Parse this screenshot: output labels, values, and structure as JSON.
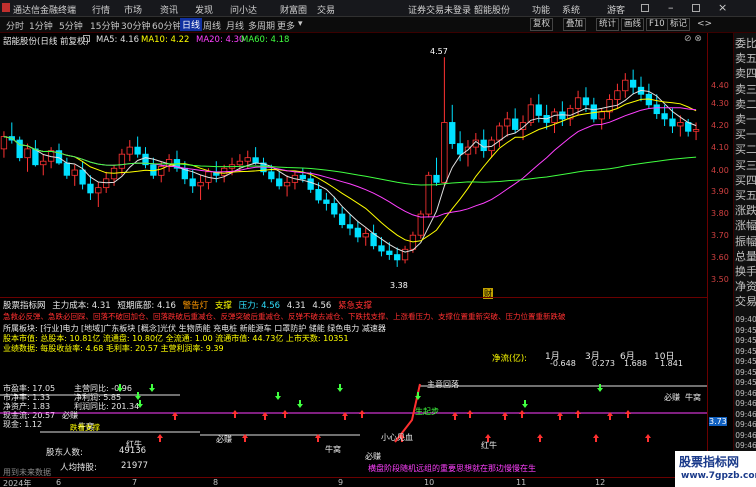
{
  "menu": {
    "app_title": "通达信金融终端",
    "items": [
      "行情",
      "市场",
      "资讯",
      "发现",
      "问小达",
      "财富圈",
      "交易"
    ],
    "notice_left": "证券交易未登录",
    "notice_right": "韶能股份",
    "right_items": [
      "功能",
      "系统",
      "游客"
    ]
  },
  "periods": {
    "items": [
      "分时",
      "1分钟",
      "5分钟",
      "15分钟",
      "30分钟",
      "60分钟",
      "日线",
      "周线",
      "月线",
      "多周期",
      "更多"
    ],
    "active_index": 6,
    "tools": [
      "复权",
      "叠加",
      "统计",
      "画线",
      "F10",
      "标记"
    ]
  },
  "main": {
    "stock_label": "韶能股份(日线 前复权)",
    "ma": [
      {
        "label": "MA5: 4.16",
        "color": "#e0e0e0"
      },
      {
        "label": "MA10: 4.22",
        "color": "#ffff00"
      },
      {
        "label": "MA20: 4.30",
        "color": "#ff40ff"
      },
      {
        "label": "MA60: 4.18",
        "color": "#40ff40"
      }
    ],
    "high_label": "4.57",
    "low_label": "3.38",
    "marker": "财"
  },
  "axis_ticks": [
    "4.40",
    "4.30",
    "4.20",
    "4.10",
    "4.00",
    "3.90",
    "3.80",
    "3.70",
    "3.60",
    "3.50"
  ],
  "sub_axis_tick": "3.73",
  "sidebar": {
    "items": [
      "委比",
      "卖五",
      "卖四",
      "卖三",
      "卖二",
      "卖一",
      "买一",
      "买二",
      "买三",
      "买四",
      "买五",
      "涨跌",
      "涨幅",
      "振幅",
      "总量",
      "换手",
      "净资",
      "交易"
    ],
    "times": [
      "09:40",
      "09:45",
      "09:45",
      "09:45",
      "09:45",
      "09:45",
      "09:45",
      "09:46",
      "09:46",
      "09:46",
      "09:46",
      "09:46",
      "09:46",
      "09:46",
      "09:46"
    ]
  },
  "indicator": {
    "header": "股票指标网",
    "main_cost": "主力成本: 4.31",
    "short_ma": "短期底部: 4.16",
    "alert": "警告灯",
    "support": "支撑",
    "pressure": "压力: 4.56",
    "v1": "4.31",
    "v2": "4.56",
    "tip": "紧急支撑",
    "line2": "急救必反弹、急跌必回踩、回落不破回加仓、回落跌破后重减仓、反弹突破后重减仓、反弹不破去减仓、下跌找支撑、上涨看压力、支撑位置重新突破、压力位置重新跌破"
  },
  "info": {
    "sector": "所属板块: [行业]电力 [地域]广东板块 [概念]光伏 生物质能 充电桩 新能源车 口罩防护 储能 绿色电力 减速器",
    "equity": "股本市值: 总股本: 10.81亿 流通盘: 10.80亿 全流通: 1.00 流通市值: 44.73亿 上市天数: 10351",
    "finance": "业绩数据: 每股收益率: 4.68 毛利率: 20.57 主营利润率: 9.39",
    "jingliu": "净流(亿):",
    "months": [
      "1月",
      "3月",
      "6月",
      "10日"
    ],
    "jl_vals": [
      "-0.648",
      "0.273",
      "1.688",
      "1.841"
    ],
    "pe_label": "市盈率: 17.05",
    "pb": "市净率: 1.33",
    "roe": "净资产: 1.83",
    "cash": "现金流: 20.57",
    "cur": "现金: 1.12",
    "growth": "主营同比: -0.96",
    "net": "净利润: 5.85",
    "profit": "利润同比: 201.34",
    "holders_label": "股东人数:",
    "holders": "49136",
    "per_label": "人均持股:",
    "per": "21977",
    "signals": [
      "主意回落",
      "生起步",
      "小心见血",
      "必赚",
      "必赚",
      "必赚",
      "必赚",
      "牛窝",
      "牛窝",
      "牛窝",
      "红牛",
      "红牛",
      "跌看支撑"
    ],
    "scroll_text": "横盘阶段随机远组的重要思想就在那边慢慢在生",
    "footer": "用到未来数据"
  },
  "dates": [
    "2024年",
    "6",
    "7",
    "8",
    "9",
    "10",
    "11",
    "12"
  ],
  "watermark": {
    "line1": "股票指标网",
    "line2": "www.7gpzb.com"
  },
  "chart_data": {
    "type": "candlestick",
    "title": "韶能股份(日线 前复权)",
    "ylim": [
      3.3,
      4.6
    ],
    "ohlc": [
      [
        4.05,
        4.15,
        4.0,
        4.12
      ],
      [
        4.12,
        4.2,
        4.08,
        4.1
      ],
      [
        4.1,
        4.12,
        3.98,
        4.0
      ],
      [
        4.0,
        4.08,
        3.92,
        4.05
      ],
      [
        4.05,
        4.1,
        3.95,
        3.96
      ],
      [
        3.96,
        4.02,
        3.9,
        3.98
      ],
      [
        3.98,
        4.06,
        3.94,
        4.04
      ],
      [
        4.04,
        4.08,
        3.96,
        3.97
      ],
      [
        3.97,
        4.0,
        3.88,
        3.9
      ],
      [
        3.9,
        3.96,
        3.84,
        3.93
      ],
      [
        3.93,
        3.98,
        3.82,
        3.85
      ],
      [
        3.85,
        3.9,
        3.76,
        3.8
      ],
      [
        3.8,
        3.86,
        3.72,
        3.83
      ],
      [
        3.83,
        3.92,
        3.8,
        3.88
      ],
      [
        3.88,
        3.96,
        3.84,
        3.94
      ],
      [
        3.94,
        4.05,
        3.9,
        4.02
      ],
      [
        4.02,
        4.1,
        3.98,
        4.06
      ],
      [
        4.06,
        4.12,
        4.0,
        4.02
      ],
      [
        4.02,
        4.06,
        3.94,
        3.96
      ],
      [
        3.96,
        4.0,
        3.88,
        3.9
      ],
      [
        3.9,
        3.98,
        3.86,
        3.95
      ],
      [
        3.95,
        4.02,
        3.92,
        3.99
      ],
      [
        3.99,
        4.04,
        3.92,
        3.94
      ],
      [
        3.94,
        3.98,
        3.85,
        3.88
      ],
      [
        3.88,
        3.93,
        3.8,
        3.84
      ],
      [
        3.84,
        3.9,
        3.76,
        3.86
      ],
      [
        3.86,
        3.94,
        3.82,
        3.92
      ],
      [
        3.92,
        3.98,
        3.86,
        3.9
      ],
      [
        3.9,
        3.96,
        3.86,
        3.94
      ],
      [
        3.94,
        4.0,
        3.9,
        3.96
      ],
      [
        3.96,
        4.02,
        3.92,
        3.98
      ],
      [
        3.98,
        4.04,
        3.94,
        4.0
      ],
      [
        4.0,
        4.06,
        3.96,
        3.97
      ],
      [
        3.97,
        4.0,
        3.9,
        3.92
      ],
      [
        3.92,
        3.96,
        3.86,
        3.88
      ],
      [
        3.88,
        3.92,
        3.82,
        3.84
      ],
      [
        3.84,
        3.9,
        3.78,
        3.86
      ],
      [
        3.86,
        3.92,
        3.82,
        3.9
      ],
      [
        3.9,
        3.94,
        3.86,
        3.88
      ],
      [
        3.88,
        3.92,
        3.8,
        3.82
      ],
      [
        3.82,
        3.86,
        3.74,
        3.76
      ],
      [
        3.76,
        3.8,
        3.7,
        3.74
      ],
      [
        3.74,
        3.78,
        3.66,
        3.68
      ],
      [
        3.68,
        3.72,
        3.6,
        3.62
      ],
      [
        3.62,
        3.68,
        3.56,
        3.6
      ],
      [
        3.6,
        3.64,
        3.52,
        3.55
      ],
      [
        3.55,
        3.6,
        3.5,
        3.57
      ],
      [
        3.57,
        3.62,
        3.48,
        3.5
      ],
      [
        3.5,
        3.55,
        3.44,
        3.47
      ],
      [
        3.47,
        3.52,
        3.42,
        3.45
      ],
      [
        3.45,
        3.49,
        3.38,
        3.42
      ],
      [
        3.42,
        3.5,
        3.4,
        3.48
      ],
      [
        3.48,
        3.58,
        3.46,
        3.56
      ],
      [
        3.56,
        3.7,
        3.54,
        3.68
      ],
      [
        3.68,
        3.92,
        3.66,
        3.9
      ],
      [
        3.9,
        4.0,
        3.84,
        3.86
      ],
      [
        3.86,
        4.57,
        3.84,
        4.2
      ],
      [
        4.2,
        4.3,
        4.05,
        4.08
      ],
      [
        4.08,
        4.15,
        3.98,
        4.02
      ],
      [
        4.02,
        4.1,
        3.95,
        4.06
      ],
      [
        4.06,
        4.14,
        4.02,
        4.1
      ],
      [
        4.1,
        4.16,
        4.0,
        4.04
      ],
      [
        4.04,
        4.12,
        4.0,
        4.1
      ],
      [
        4.1,
        4.2,
        4.06,
        4.18
      ],
      [
        4.18,
        4.26,
        4.12,
        4.22
      ],
      [
        4.22,
        4.28,
        4.14,
        4.16
      ],
      [
        4.16,
        4.24,
        4.1,
        4.2
      ],
      [
        4.2,
        4.34,
        4.18,
        4.3
      ],
      [
        4.3,
        4.36,
        4.2,
        4.24
      ],
      [
        4.24,
        4.3,
        4.16,
        4.2
      ],
      [
        4.2,
        4.28,
        4.14,
        4.26
      ],
      [
        4.26,
        4.32,
        4.18,
        4.22
      ],
      [
        4.22,
        4.3,
        4.18,
        4.28
      ],
      [
        4.28,
        4.38,
        4.24,
        4.34
      ],
      [
        4.34,
        4.4,
        4.26,
        4.3
      ],
      [
        4.3,
        4.34,
        4.2,
        4.22
      ],
      [
        4.22,
        4.28,
        4.16,
        4.26
      ],
      [
        4.26,
        4.36,
        4.22,
        4.33
      ],
      [
        4.33,
        4.42,
        4.28,
        4.38
      ],
      [
        4.38,
        4.48,
        4.34,
        4.44
      ],
      [
        4.44,
        4.5,
        4.36,
        4.4
      ],
      [
        4.4,
        4.46,
        4.32,
        4.36
      ],
      [
        4.36,
        4.42,
        4.28,
        4.3
      ],
      [
        4.3,
        4.36,
        4.22,
        4.25
      ],
      [
        4.25,
        4.3,
        4.18,
        4.22
      ],
      [
        4.22,
        4.28,
        4.14,
        4.18
      ],
      [
        4.18,
        4.24,
        4.12,
        4.2
      ],
      [
        4.2,
        4.22,
        4.12,
        4.15
      ],
      [
        4.15,
        4.2,
        4.1,
        4.16
      ]
    ]
  }
}
